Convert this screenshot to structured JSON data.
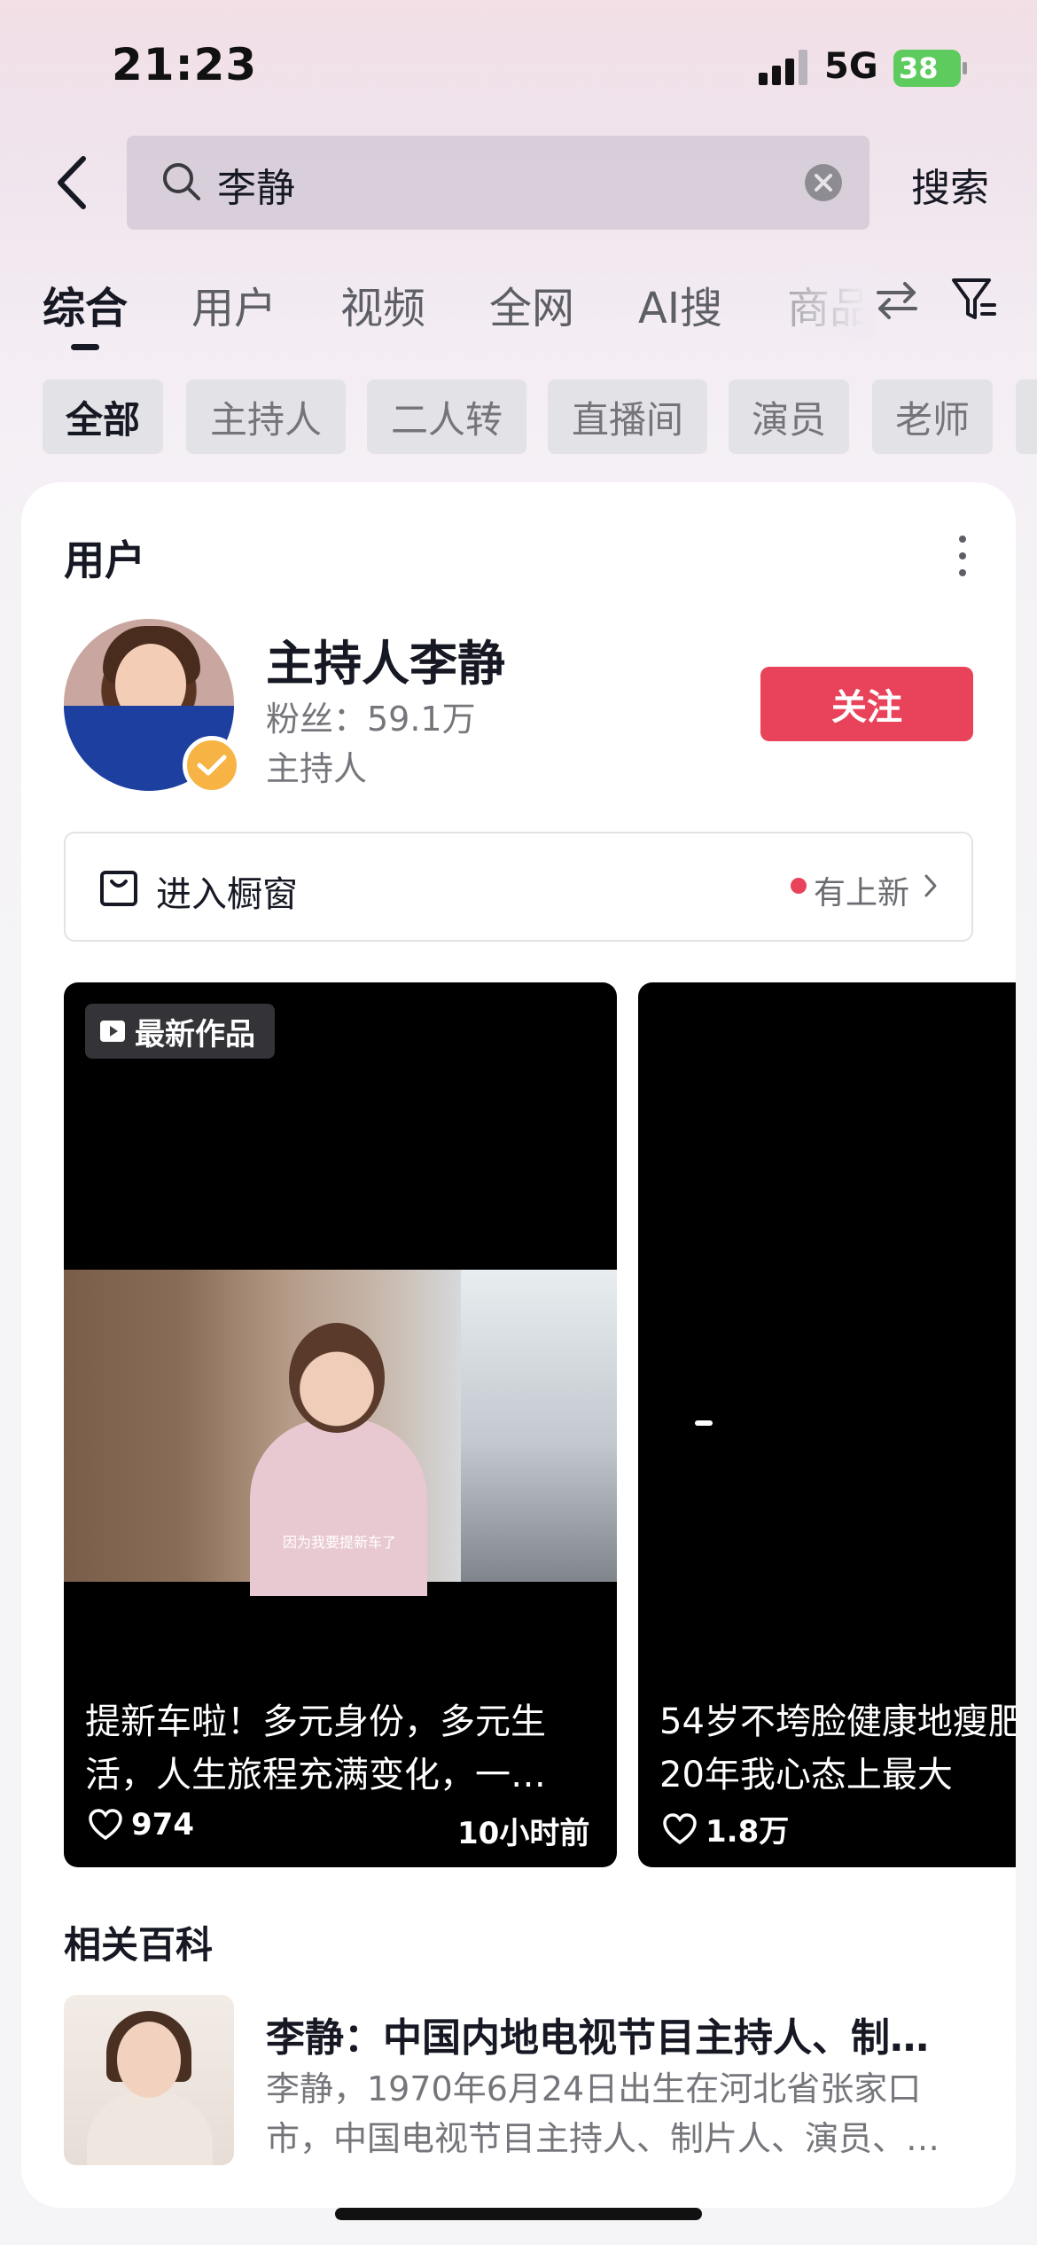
{
  "status_bar": {
    "time": "21:23",
    "network": "5G",
    "battery": "38"
  },
  "search": {
    "query": "李静",
    "submit_label": "搜索"
  },
  "tabs": [
    "综合",
    "用户",
    "视频",
    "全网",
    "AI搜",
    "商品"
  ],
  "chips": [
    "全部",
    "主持人",
    "二人转",
    "直播间",
    "演员",
    "老师"
  ],
  "user_section": {
    "title": "用户",
    "name": "主持人李静",
    "fans": "粉丝：59.1万",
    "role": "主持人",
    "follow_label": "关注",
    "shop_label": "进入橱窗",
    "shop_new": "有上新"
  },
  "videos": [
    {
      "badge": "最新作品",
      "subtitle": "因为我要提新车了",
      "title": "提新车啦！多元身份，多元生活，人生旅程充满变化，一…",
      "likes": "974",
      "time": "10小时前"
    },
    {
      "title": "54岁不垮脸健康地瘦肥20年我心态上最大",
      "likes": "1.8万"
    }
  ],
  "wiki": {
    "section_title": "相关百科",
    "headline": "李静：中国内地电视节目主持人、制…",
    "description": "李静，1970年6月24日出生在河北省张家口市，中国电视节目主持人、制片人、演员、…"
  },
  "colors": {
    "accent": "#e8435a",
    "verified": "#f7b445",
    "battery": "#5ecb5e"
  }
}
